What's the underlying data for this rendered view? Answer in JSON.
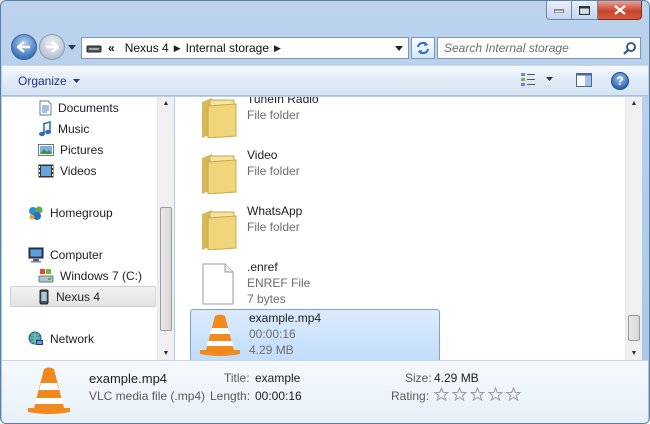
{
  "window": {
    "address_crumbs": [
      "Nexus 4",
      "Internal storage"
    ],
    "overflow_chevron": "«",
    "search_placeholder": "Search Internal storage"
  },
  "command_bar": {
    "organize_label": "Organize"
  },
  "nav_pane": {
    "items": [
      {
        "label": "Documents",
        "icon": "documents-icon"
      },
      {
        "label": "Music",
        "icon": "music-icon"
      },
      {
        "label": "Pictures",
        "icon": "pictures-icon"
      },
      {
        "label": "Videos",
        "icon": "videos-icon"
      },
      {
        "label": "Homegroup",
        "icon": "homegroup-icon"
      },
      {
        "label": "Computer",
        "icon": "computer-icon"
      },
      {
        "label": "Windows 7 (C:)",
        "icon": "drive-icon"
      },
      {
        "label": "Nexus 4",
        "icon": "device-icon",
        "selected": true
      },
      {
        "label": "Network",
        "icon": "network-icon"
      }
    ]
  },
  "content": {
    "items": [
      {
        "name": "TuneIn Radio",
        "line2": "File folder",
        "line3": "",
        "icon": "folder-icon"
      },
      {
        "name": "Video",
        "line2": "File folder",
        "line3": "",
        "icon": "folder-icon"
      },
      {
        "name": "WhatsApp",
        "line2": "File folder",
        "line3": "",
        "icon": "folder-icon"
      },
      {
        "name": ".enref",
        "line2": "ENREF File",
        "line3": "7 bytes",
        "icon": "blank-file-icon"
      },
      {
        "name": "example.mp4",
        "line2": "00:00:16",
        "line3": "4.29 MB",
        "icon": "vlc-cone-icon",
        "selected": true
      }
    ]
  },
  "details": {
    "name": "example.mp4",
    "type": "VLC media file (.mp4)",
    "title_label": "Title:",
    "title_value": "example",
    "length_label": "Length:",
    "length_value": "00:00:16",
    "size_label": "Size:",
    "size_value": "4.29 MB",
    "rating_label": "Rating:",
    "rating_stars": 0,
    "rating_max": 5
  },
  "colors": {
    "frame": "#a9c5e6",
    "link_blue": "#1e3287",
    "selection": "#c1dcfc",
    "folder_yellow": "#f1d57a",
    "vlc_orange": "#f08a1c"
  }
}
